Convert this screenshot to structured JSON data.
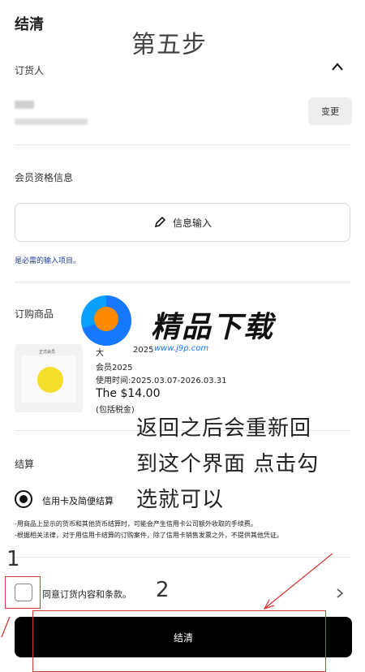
{
  "header": {
    "title": "结清",
    "step_overlay": "第五步"
  },
  "orderer": {
    "label": "订货人",
    "change_label": "变更"
  },
  "membership": {
    "label": "会员资格信息",
    "info_button": "信息输入",
    "required_note": "是必需的输入项目。"
  },
  "products": {
    "label": "订购商品",
    "name_fragment": "大",
    "name_fragment2": "2025",
    "subtitle": "会员2025",
    "usage": "使用时间:2025.03.07-2026.03.31",
    "price": "The $14.00",
    "tax": "(包括税金)",
    "image_caption": "正式会员"
  },
  "payment": {
    "label": "结算",
    "method": "信用卡及简便结算",
    "note1": "-用商品上显示的货币和其他货币结算时，可能会产生信用卡公司额外收取的手续费。",
    "note2": "-根据相关法律，对于用信用卡结算的订购案件，除了信用卡销售发票之外，不提供其他凭证。"
  },
  "agreement": {
    "label": "同意订货内容和条款。"
  },
  "checkout": {
    "label": "结清"
  },
  "annotations": {
    "num1": "1",
    "num2": "2",
    "line1": "返回之后会重新回",
    "line2": "到这个界面 点击勾",
    "line3": "选就可以"
  },
  "watermark": {
    "text": "精品下载",
    "url": "www.j9p.com"
  },
  "colors": {
    "annotation_red": "#d43a3a",
    "checkout_bg": "#000000",
    "link_blue": "#1f3b8f"
  }
}
